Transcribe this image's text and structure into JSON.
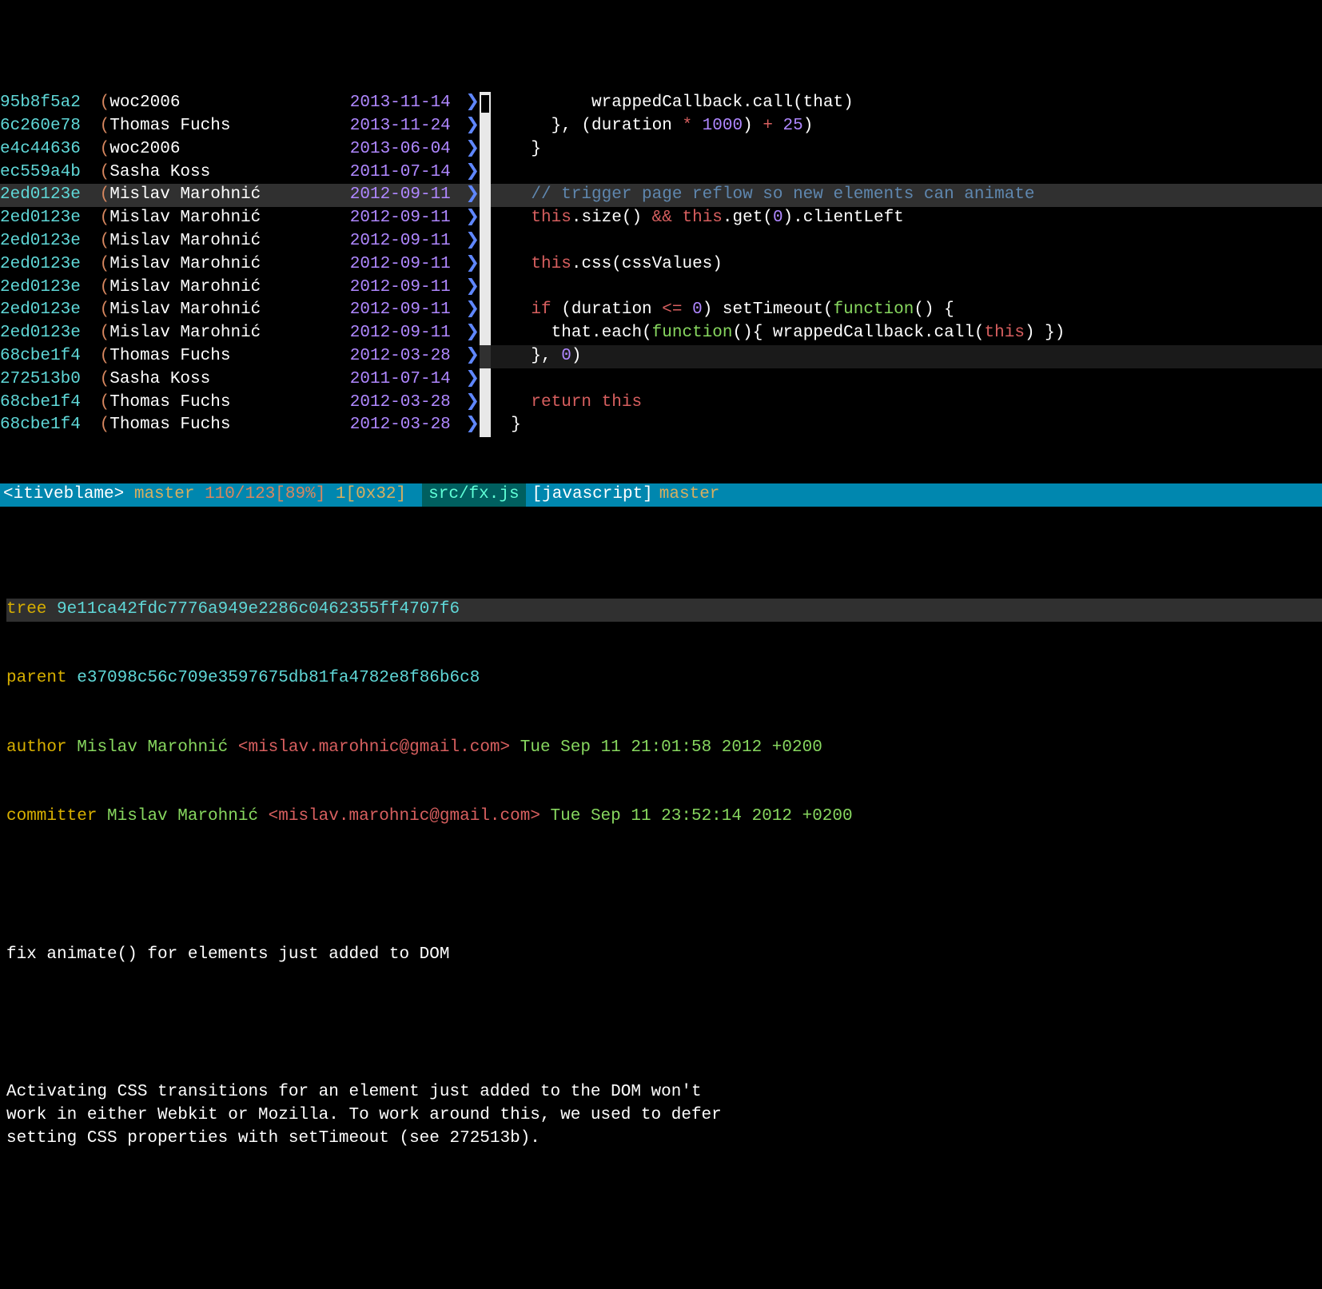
{
  "blame": [
    {
      "hash": "95b8f5a2",
      "author": "woc",
      "authorNum": "2006",
      "date": "2013-11-14",
      "hl": false,
      "cursor": true
    },
    {
      "hash": "6c260e78",
      "author": "Thomas Fuchs",
      "authorNum": "",
      "date": "2013-11-24",
      "hl": false
    },
    {
      "hash": "e4c44636",
      "author": "woc",
      "authorNum": "2006",
      "date": "2013-06-04",
      "hl": false
    },
    {
      "hash": "ec559a4b",
      "author": "Sasha Koss",
      "authorNum": "",
      "date": "2011-07-14",
      "hl": false
    },
    {
      "hash": "2ed0123e",
      "author": "Mislav Marohnić",
      "authorNum": "",
      "date": "2012-09-11",
      "hl": true
    },
    {
      "hash": "2ed0123e",
      "author": "Mislav Marohnić",
      "authorNum": "",
      "date": "2012-09-11",
      "hl": false
    },
    {
      "hash": "2ed0123e",
      "author": "Mislav Marohnić",
      "authorNum": "",
      "date": "2012-09-11",
      "hl": false
    },
    {
      "hash": "2ed0123e",
      "author": "Mislav Marohnić",
      "authorNum": "",
      "date": "2012-09-11",
      "hl": false
    },
    {
      "hash": "2ed0123e",
      "author": "Mislav Marohnić",
      "authorNum": "",
      "date": "2012-09-11",
      "hl": false
    },
    {
      "hash": "2ed0123e",
      "author": "Mislav Marohnić",
      "authorNum": "",
      "date": "2012-09-11",
      "hl": false
    },
    {
      "hash": "2ed0123e",
      "author": "Mislav Marohnić",
      "authorNum": "",
      "date": "2012-09-11",
      "hl": false
    },
    {
      "hash": "68cbe1f4",
      "author": "Thomas Fuchs",
      "authorNum": "",
      "date": "2012-03-28",
      "hl": false,
      "dark": true
    },
    {
      "hash": "272513b0",
      "author": "Sasha Koss",
      "authorNum": "",
      "date": "2011-07-14",
      "hl": false
    },
    {
      "hash": "68cbe1f4",
      "author": "Thomas Fuchs",
      "authorNum": "",
      "date": "2012-03-28",
      "hl": false
    },
    {
      "hash": "68cbe1f4",
      "author": "Thomas Fuchs",
      "authorNum": "",
      "date": "2012-03-28",
      "hl": false
    }
  ],
  "code": [
    {
      "indent": "          ",
      "tokens": [
        {
          "t": "wrappedCallback.call(that)",
          "c": "c-op"
        }
      ]
    },
    {
      "indent": "      ",
      "tokens": [
        {
          "t": "}, (duration ",
          "c": "c-op"
        },
        {
          "t": "*",
          "c": "c-kw"
        },
        {
          "t": " ",
          "c": "c-op"
        },
        {
          "t": "1000",
          "c": "c-num"
        },
        {
          "t": ") ",
          "c": "c-op"
        },
        {
          "t": "+",
          "c": "c-kw"
        },
        {
          "t": " ",
          "c": "c-op"
        },
        {
          "t": "25",
          "c": "c-num"
        },
        {
          "t": ")",
          "c": "c-op"
        }
      ]
    },
    {
      "indent": "    ",
      "tokens": [
        {
          "t": "}",
          "c": "c-op"
        }
      ]
    },
    {
      "indent": "",
      "tokens": []
    },
    {
      "indent": "    ",
      "tokens": [
        {
          "t": "// trigger page reflow so new elements can animate",
          "c": "c-cm"
        }
      ],
      "hl": true
    },
    {
      "indent": "    ",
      "tokens": [
        {
          "t": "this",
          "c": "c-this"
        },
        {
          "t": ".size() ",
          "c": "c-op"
        },
        {
          "t": "&&",
          "c": "c-kw"
        },
        {
          "t": " ",
          "c": "c-op"
        },
        {
          "t": "this",
          "c": "c-this"
        },
        {
          "t": ".get(",
          "c": "c-op"
        },
        {
          "t": "0",
          "c": "c-num"
        },
        {
          "t": ").clientLeft",
          "c": "c-op"
        }
      ]
    },
    {
      "indent": "",
      "tokens": []
    },
    {
      "indent": "    ",
      "tokens": [
        {
          "t": "this",
          "c": "c-this"
        },
        {
          "t": ".css(cssValues)",
          "c": "c-op"
        }
      ]
    },
    {
      "indent": "",
      "tokens": []
    },
    {
      "indent": "    ",
      "tokens": [
        {
          "t": "if",
          "c": "c-kw"
        },
        {
          "t": " (duration ",
          "c": "c-op"
        },
        {
          "t": "<=",
          "c": "c-kw"
        },
        {
          "t": " ",
          "c": "c-op"
        },
        {
          "t": "0",
          "c": "c-num"
        },
        {
          "t": ") setTimeout(",
          "c": "c-op"
        },
        {
          "t": "function",
          "c": "c-fn"
        },
        {
          "t": "() {",
          "c": "c-op"
        }
      ]
    },
    {
      "indent": "      ",
      "tokens": [
        {
          "t": "that.each(",
          "c": "c-op"
        },
        {
          "t": "function",
          "c": "c-fn"
        },
        {
          "t": "(){ wrappedCallback.call(",
          "c": "c-op"
        },
        {
          "t": "this",
          "c": "c-this"
        },
        {
          "t": ") })",
          "c": "c-op"
        }
      ]
    },
    {
      "indent": "    ",
      "tokens": [
        {
          "t": "}, ",
          "c": "c-op"
        },
        {
          "t": "0",
          "c": "c-num"
        },
        {
          "t": ")",
          "c": "c-op"
        }
      ],
      "hl2": true
    },
    {
      "indent": "",
      "tokens": []
    },
    {
      "indent": "    ",
      "tokens": [
        {
          "t": "return",
          "c": "c-kw"
        },
        {
          "t": " ",
          "c": "c-op"
        },
        {
          "t": "this",
          "c": "c-this"
        }
      ]
    },
    {
      "indent": "  ",
      "tokens": [
        {
          "t": "}",
          "c": "c-op"
        }
      ]
    }
  ],
  "status": {
    "mode": "<itiveblame>",
    "branch": "master",
    "pos": "110/123[89%]",
    "col": "1[0x32]",
    "file": "src/fx.js",
    "lang": "[javascript]",
    "branch2": "master"
  },
  "commit": {
    "tree_label": "tree",
    "tree": "9e11ca42fdc7776a949e2286c0462355ff4707f6",
    "parent_label": "parent",
    "parent": "e37098c56c709e3597675db81fa4782e8f86b6c8",
    "author_label": "author",
    "author_name": "Mislav Marohnić",
    "author_email": "<mislav.marohnic@gmail.com>",
    "author_date": "Tue Sep 11 21:01:58 2012 +0200",
    "committer_label": "committer",
    "committer_name": "Mislav Marohnić",
    "committer_email": "<mislav.marohnic@gmail.com>",
    "committer_date": "Tue Sep 11 23:52:14 2012 +0200",
    "msg_title": "fix animate() for elements just added to DOM",
    "msg_body": "Activating CSS transitions for an element just added to the DOM won't\nwork in either Webkit or Mozilla. To work around this, we used to defer\nsetting CSS properties with setTimeout (see 272513b)."
  }
}
